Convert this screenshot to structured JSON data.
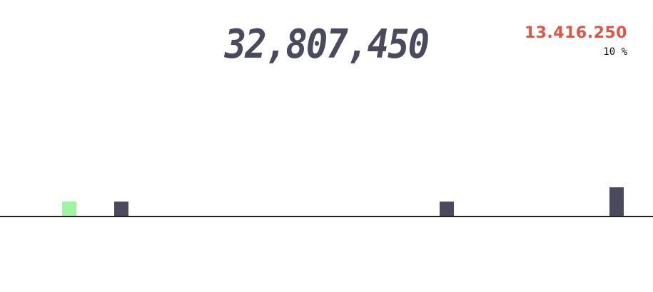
{
  "hud": {
    "score": "32,807,450",
    "best": "13.416.250",
    "progress_label": "10 %",
    "progress": 0.1
  },
  "colors": {
    "score": "#4b4a5c",
    "best": "#e05443",
    "block": "#4b4a5c",
    "player": "#9df5a1",
    "ground": "#222222"
  },
  "world": {
    "player": {
      "position": 0.106,
      "height": 1
    },
    "obstacles": [
      {
        "position": 0.186,
        "height": 1
      },
      {
        "position": 0.684,
        "height": 1
      },
      {
        "position": 0.944,
        "height": 2
      }
    ]
  }
}
